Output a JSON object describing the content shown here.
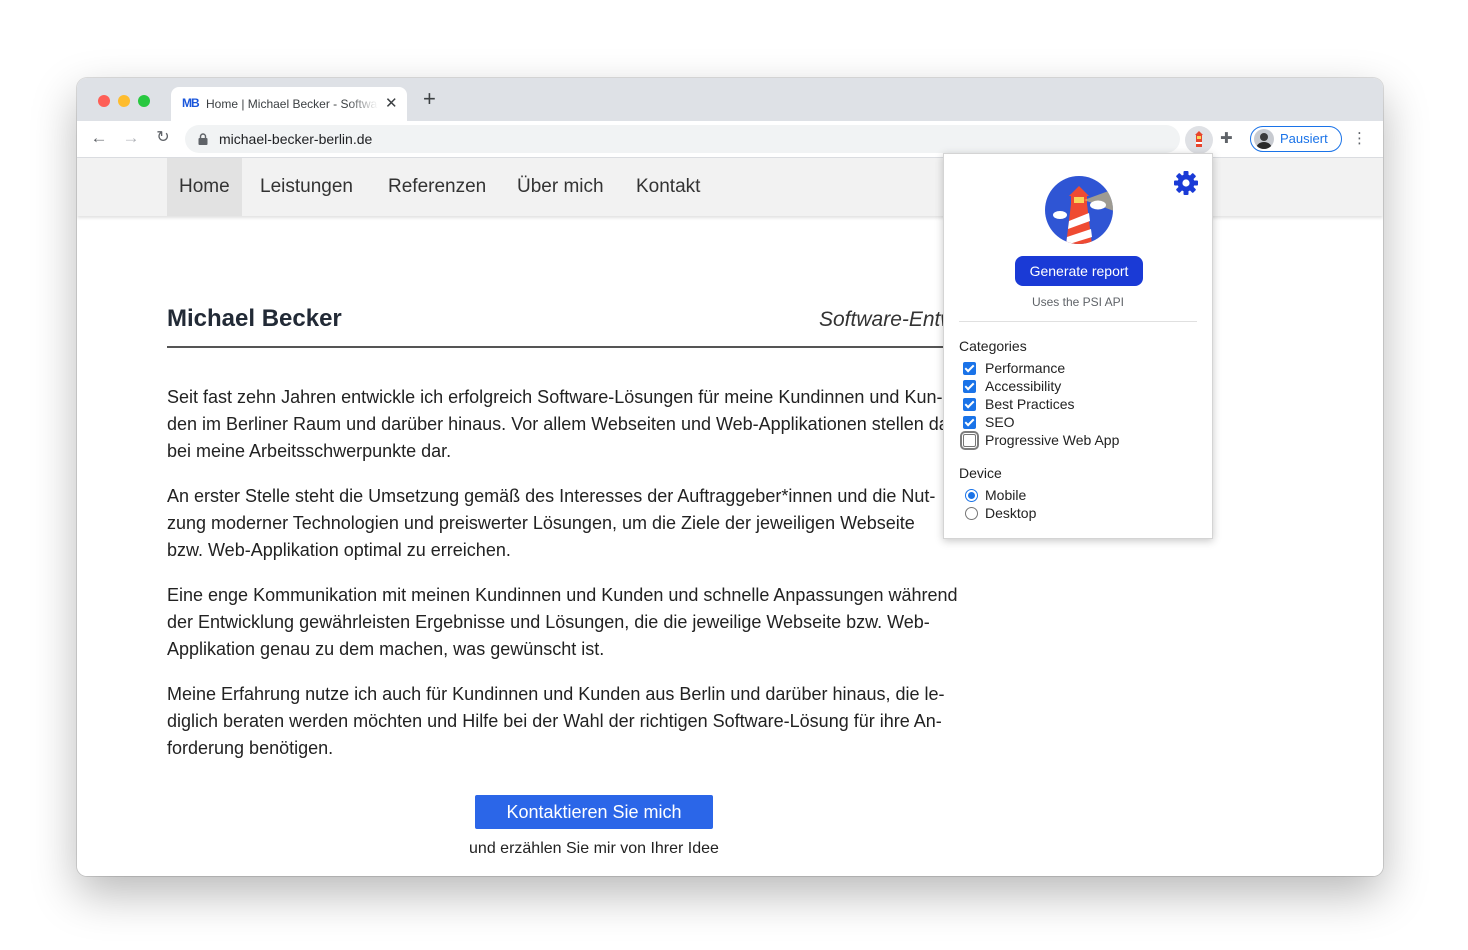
{
  "browser": {
    "tab": {
      "favicon_text": "MB",
      "title": "Home | Michael Becker - Software-Entwickler"
    },
    "new_tab_symbol": "+",
    "url": "michael-becker-berlin.de",
    "profile_label": "Pausiert",
    "icons": {
      "back": "arrow-left-icon",
      "forward": "arrow-right-icon",
      "reload": "reload-icon",
      "lock": "lock-icon",
      "bookmark": "star-icon",
      "extension_active": "lighthouse-icon",
      "extensions": "puzzle-icon",
      "menu": "kebab-icon"
    }
  },
  "site": {
    "nav": [
      {
        "label": "Home",
        "active": true
      },
      {
        "label": "Leistungen",
        "active": false
      },
      {
        "label": "Referenzen",
        "active": false
      },
      {
        "label": "Über mich",
        "active": false
      },
      {
        "label": "Kontakt",
        "active": false
      }
    ],
    "name": "Michael Becker",
    "role": "Software-Entwickler",
    "paragraphs": [
      "Seit fast zehn Jahren entwickle ich erfolgreich Software-Lösungen für meine Kundinnen und Kun-\nden im Berliner Raum und darüber hinaus. Vor allem Webseiten und Web-Applikationen stellen da-\nbei meine Arbeitsschwerpunkte dar.",
      "An erster Stelle steht die Umsetzung gemäß des Interesses der Auftraggeber*innen und die Nut-\nzung moderner Technologien und preiswerter Lösungen, um die Ziele der jeweiligen Webseite\nbzw. Web-Applikation optimal zu erreichen.",
      "Eine enge Kommunikation mit meinen Kundinnen und Kunden und schnelle Anpassungen während\nder Entwicklung gewährleisten Ergebnisse und Lösungen, die die jeweilige Webseite bzw. Web-\nApplikation genau zu dem machen, was gewünscht ist.",
      "Meine Erfahrung nutze ich auch für Kundinnen und Kunden aus Berlin und darüber hinaus, die le-\ndiglich beraten werden möchten und Hilfe bei der Wahl der richtigen Software-Lösung für ihre An-\nforderung benötigen."
    ],
    "cta_label": "Kontaktieren Sie mich",
    "cta_sub": "und erzählen Sie mir von Ihrer Idee"
  },
  "lighthouse": {
    "generate_label": "Generate report",
    "psi_note": "Uses the PSI API",
    "categories_title": "Categories",
    "categories": [
      {
        "label": "Performance",
        "checked": true
      },
      {
        "label": "Accessibility",
        "checked": true
      },
      {
        "label": "Best Practices",
        "checked": true
      },
      {
        "label": "SEO",
        "checked": true
      },
      {
        "label": "Progressive Web App",
        "checked": false
      }
    ],
    "device_title": "Device",
    "devices": [
      {
        "label": "Mobile",
        "selected": true
      },
      {
        "label": "Desktop",
        "selected": false
      }
    ]
  },
  "colors": {
    "accent": "#1a73e8",
    "generate_button": "#1a3ad6",
    "cta_button": "#2b66e8",
    "nav_background": "#f2f2f2"
  }
}
